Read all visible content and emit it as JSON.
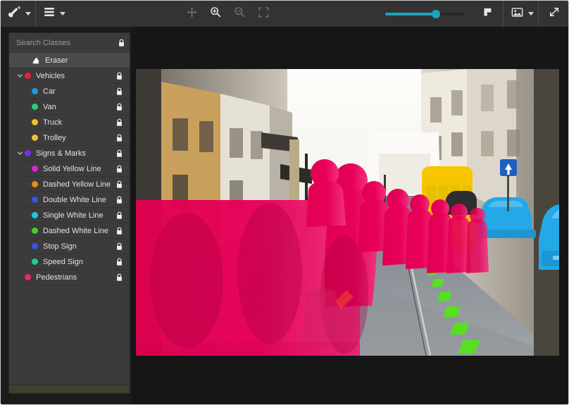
{
  "toolbar": {
    "brush_tool": {
      "icon": "brush-icon",
      "label": "Brush"
    },
    "brush_dropdown": {
      "icon": "chevron-down-icon"
    },
    "layers_tool": {
      "icon": "layers-icon",
      "label": "Layers"
    },
    "layers_dropdown": {
      "icon": "chevron-down-icon"
    },
    "move_tool": {
      "icon": "move-icon",
      "label": "Move"
    },
    "zoom_in_tool": {
      "icon": "zoom-in-icon",
      "label": "Zoom In"
    },
    "zoom_out_tool": {
      "icon": "zoom-out-icon",
      "label": "Zoom Out"
    },
    "fit_screen_tool": {
      "icon": "fit-screen-icon",
      "label": "Fit to Screen"
    },
    "opacity_slider": {
      "value": 64,
      "min": 0,
      "max": 100,
      "fill_color": "#1aa3bd"
    },
    "flag_tool": {
      "icon": "flag-icon",
      "label": "Flag"
    },
    "image_tool": {
      "icon": "image-icon",
      "label": "Image"
    },
    "image_dropdown": {
      "icon": "chevron-down-icon"
    },
    "expand_tool": {
      "icon": "expand-arrows-icon",
      "label": "Expand"
    }
  },
  "sidebar": {
    "search": {
      "placeholder": "Search Classes",
      "value": "",
      "lock_icon": "lock-closed-icon"
    },
    "eraser": {
      "label": "Eraser",
      "icon": "eraser-icon",
      "selected": true
    },
    "classes": [
      {
        "label": "Vehicles",
        "color": "#e8262f",
        "level": 0,
        "expanded": true,
        "locked": true
      },
      {
        "label": "Car",
        "color": "#1e9be8",
        "level": 1,
        "expanded": null,
        "locked": true
      },
      {
        "label": "Van",
        "color": "#26d07c",
        "level": 1,
        "expanded": null,
        "locked": true
      },
      {
        "label": "Truck",
        "color": "#e8c424",
        "level": 1,
        "expanded": null,
        "locked": true
      },
      {
        "label": "Trolley",
        "color": "#e8c424",
        "level": 1,
        "expanded": null,
        "locked": true
      },
      {
        "label": "Signs & Marks",
        "color": "#7a2ee8",
        "level": 0,
        "expanded": true,
        "locked": true
      },
      {
        "label": "Solid Yellow Line",
        "color": "#d926d9",
        "level": 1,
        "expanded": null,
        "locked": true
      },
      {
        "label": "Dashed Yellow Line",
        "color": "#e8881e",
        "level": 1,
        "expanded": null,
        "locked": true
      },
      {
        "label": "Double White Line",
        "color": "#3355e8",
        "level": 1,
        "expanded": null,
        "locked": true
      },
      {
        "label": "Single White Line",
        "color": "#1ecbe0",
        "level": 1,
        "expanded": null,
        "locked": true
      },
      {
        "label": "Dashed White Line",
        "color": "#3fd426",
        "level": 1,
        "expanded": null,
        "locked": true
      },
      {
        "label": "Stop Sign",
        "color": "#3355e8",
        "level": 1,
        "expanded": null,
        "locked": true
      },
      {
        "label": "Speed Sign",
        "color": "#1fd18a",
        "level": 1,
        "expanded": null,
        "locked": true
      },
      {
        "label": "Pedestrians",
        "color": "#e82a5e",
        "level": 0,
        "expanded": null,
        "locked": true
      }
    ]
  },
  "canvas": {
    "background_color": "#161616",
    "annotations": {
      "pedestrians_color": "#e8005a",
      "trolley_color": "#f7c600",
      "car_color": "#23a8e8",
      "dashed_white_line_color": "#55e022"
    }
  }
}
